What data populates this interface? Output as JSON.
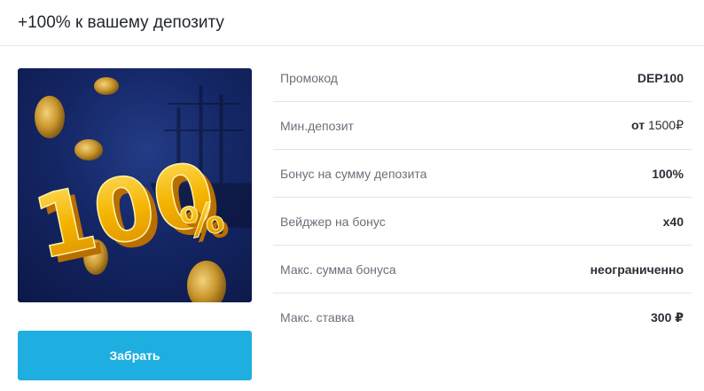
{
  "header": {
    "title": "+100% к вашему депозиту"
  },
  "promo": {
    "image_text": "100%",
    "button_label": "Забрать"
  },
  "details": [
    {
      "label": "Промокод",
      "value": "DEP100"
    },
    {
      "label": "Мин.депозит",
      "value_prefix": "от",
      "value": "1500₽"
    },
    {
      "label": "Бонус на сумму депозита",
      "value": "100%"
    },
    {
      "label": "Вейджер на бонус",
      "value": "x40"
    },
    {
      "label": "Макс. сумма бонуса",
      "value": "неограниченно"
    },
    {
      "label": "Макс. ставка",
      "value": "300 ₽"
    }
  ],
  "colors": {
    "button": "#1eaee0",
    "image_background": "#142665",
    "gold": "#f4b400"
  }
}
